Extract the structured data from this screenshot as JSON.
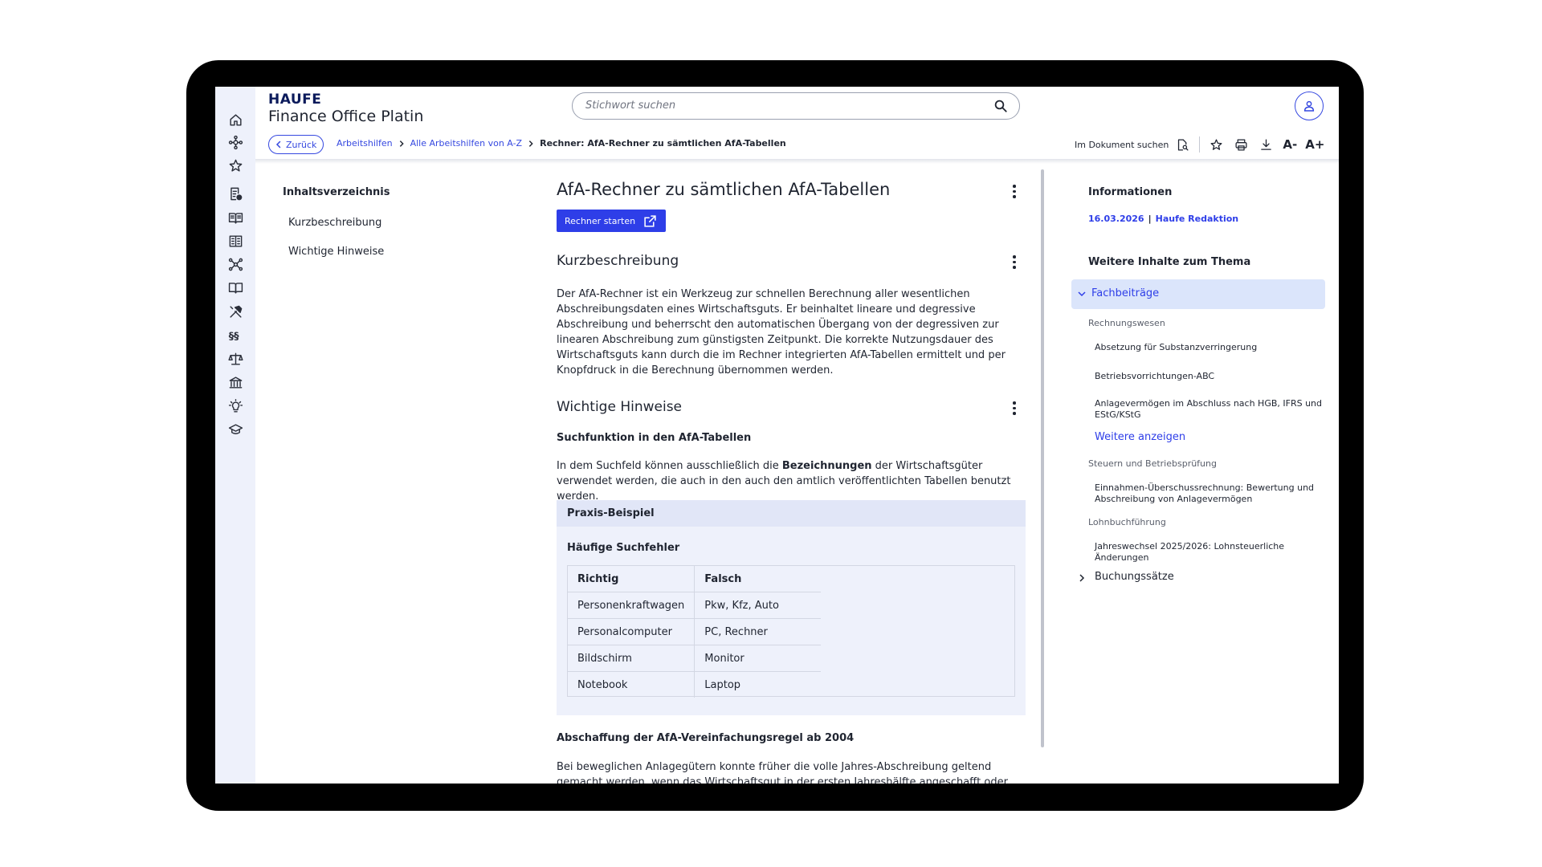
{
  "header": {
    "brand": "HAUFE",
    "product": "Finance Office Platin",
    "search_placeholder": "Stichwort suchen"
  },
  "breadcrumb": {
    "back_label": "Zurück",
    "items": [
      "Arbeitshilfen",
      "Alle Arbeitshilfen von A-Z"
    ],
    "current": "Rechner: AfA-Rechner zu sämtlichen AfA-Tabellen"
  },
  "tools": {
    "doc_search_label": "Im Dokument suchen",
    "font_smaller": "A-",
    "font_larger": "A+"
  },
  "toc": {
    "title": "Inhaltsverzeichnis",
    "items": [
      "Kurzbeschreibung",
      "Wichtige Hinweise"
    ]
  },
  "article": {
    "title": "AfA-Rechner zu sämtlichen AfA-Tabellen",
    "start_button": "Rechner starten",
    "section1_title": "Kurzbeschreibung",
    "section1_text": "Der AfA-Rechner ist ein Werkzeug zur schnellen Berechnung aller wesentlichen Abschreibungsdaten eines Wirtschaftsguts. Er beinhaltet lineare und degressive Abschreibung und beherrscht den automatischen Übergang von der degressiven zur linearen Abschreibung zum günstigsten Zeitpunkt. Die korrekte Nutzungsdauer des Wirtschaftsguts kann durch die im Rechner integrierten AfA-Tabellen ermittelt und per Knopfdruck in die Berechnung übernommen werden.",
    "section2_title": "Wichtige Hinweise",
    "sub1_title": "Suchfunktion in den AfA-Tabellen",
    "sub1_text_pre": "In dem Suchfeld können ausschließlich die ",
    "sub1_text_bold": "Bezeichnungen",
    "sub1_text_post": " der Wirtschaftsgüter verwendet werden, die auch in den auch den amtlich veröffentlichten Tabellen benutzt werden.",
    "praxis_label": "Praxis-Beispiel",
    "praxis_sub": "Häufige Suchfehler",
    "table": {
      "headers": [
        "Richtig",
        "Falsch"
      ],
      "rows": [
        [
          "Personenkraftwagen",
          "Pkw, Kfz, Auto"
        ],
        [
          "Personalcomputer",
          "PC, Rechner"
        ],
        [
          "Bildschirm",
          "Monitor"
        ],
        [
          "Notebook",
          "Laptop"
        ]
      ]
    },
    "sub2_title": "Abschaffung der AfA-Vereinfachungsregel ab 2004",
    "sub2_text": "Bei beweglichen Anlagegütern konnte früher die volle Jahres-Abschreibung geltend gemacht werden, wenn das Wirtschaftsgut in der ersten Jahreshälfte angeschafft oder hergestellt"
  },
  "info": {
    "title": "Informationen",
    "date": "16.03.2026",
    "author": "Haufe Redaktion",
    "more_title": "Weitere Inhalte zum Thema",
    "group1": "Fachbeiträge",
    "cat1": "Rechnungswesen",
    "cat1_items": [
      "Absetzung für Substanzverringerung",
      "Betriebsvorrichtungen-ABC",
      "Anlagevermögen im Abschluss nach HGB, IFRS und EStG/KStG"
    ],
    "show_more": "Weitere anzeigen",
    "cat2": "Steuern und Betriebsprüfung",
    "cat2_items": [
      "Einnahmen-Überschussrechnung: Bewertung und Abschreibung von Anlagevermögen"
    ],
    "cat3": "Lohnbuchführung",
    "cat3_items": [
      "Jahreswechsel 2025/2026: Lohnsteuerliche Änderungen"
    ],
    "group2": "Buchungssätze"
  },
  "colors": {
    "accent": "#2e3ee8",
    "sidebar_bg": "#eef1fb",
    "highlight_bg": "#dbe5fb",
    "frame": "#000000"
  },
  "icons": {
    "sidebar": [
      "home-icon",
      "hub-icon",
      "star-icon",
      "document-settings-icon",
      "open-book-icon",
      "news-icon",
      "network-icon",
      "book-icon",
      "tools-icon",
      "paragraph-icon",
      "scales-icon",
      "bank-icon",
      "lightbulb-icon",
      "graduation-cap-icon"
    ]
  }
}
